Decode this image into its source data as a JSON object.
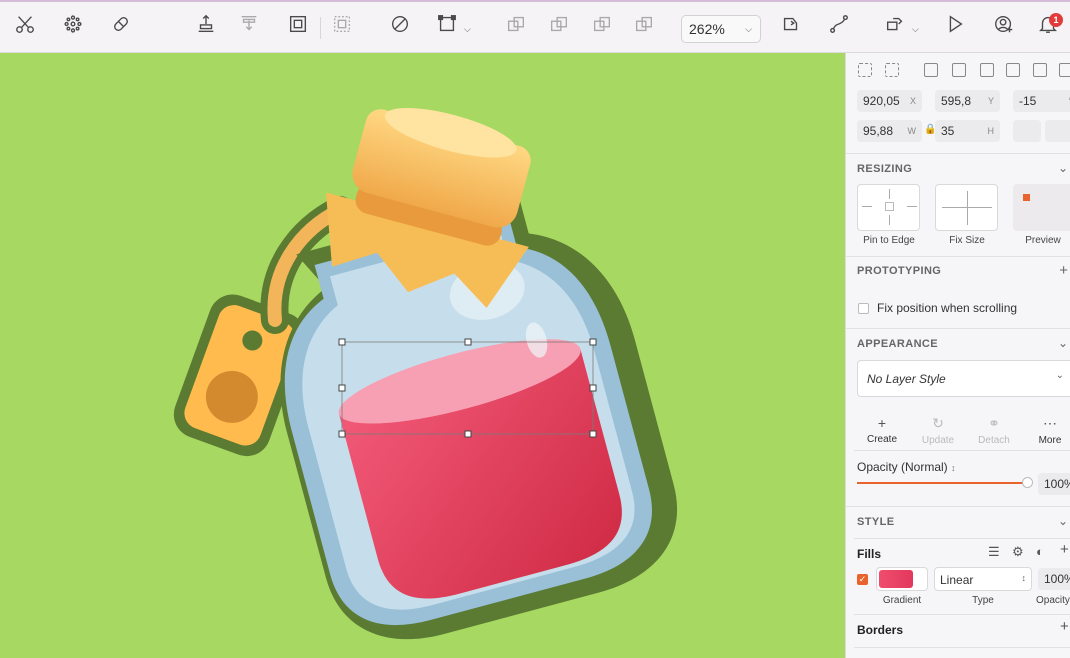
{
  "toolbar": {
    "tools": [
      {
        "name": "scissors-icon"
      },
      {
        "name": "symbol-icon"
      },
      {
        "name": "insert-image-icon"
      },
      {
        "name": "align-bottom-icon"
      },
      {
        "name": "distribute-icon"
      },
      {
        "name": "group-icon"
      },
      {
        "name": "ungroup-icon"
      },
      {
        "name": "mask-icon"
      },
      {
        "name": "transform-icon"
      },
      {
        "name": "union-icon"
      },
      {
        "name": "subtract-icon"
      },
      {
        "name": "intersect-icon"
      },
      {
        "name": "difference-icon"
      },
      {
        "name": "forward-icon"
      },
      {
        "name": "path-edit-icon"
      },
      {
        "name": "prototype-link-icon"
      },
      {
        "name": "play-icon"
      },
      {
        "name": "add-user-icon"
      },
      {
        "name": "bell-icon"
      }
    ],
    "zoom": "262%",
    "notification_count": "1"
  },
  "canvas": {
    "accent_background": "#a6d862",
    "selection_color": "#5a5a5a"
  },
  "inspector": {
    "position": {
      "x": "920,05",
      "x_label": "X",
      "y": "595,8",
      "y_label": "Y",
      "rotation": "-15",
      "rotation_unit": "°"
    },
    "size": {
      "w": "95,88",
      "w_label": "W",
      "h": "35",
      "h_label": "H"
    },
    "resizing": {
      "title": "RESIZING",
      "options": [
        "Pin to Edge",
        "Fix Size",
        "Preview"
      ]
    },
    "prototyping": {
      "title": "PROTOTYPING",
      "fix_position_label": "Fix position when scrolling",
      "fix_position_checked": false
    },
    "appearance": {
      "title": "APPEARANCE",
      "layer_style": "No Layer Style",
      "actions": [
        {
          "label": "Create",
          "icon": "plus-icon",
          "enabled": true
        },
        {
          "label": "Update",
          "icon": "refresh-icon",
          "enabled": false
        },
        {
          "label": "Detach",
          "icon": "detach-icon",
          "enabled": false
        },
        {
          "label": "More",
          "icon": "more-icon",
          "enabled": true
        }
      ],
      "opacity_label": "Opacity (Normal)",
      "opacity_value": "100%",
      "opacity_fraction": 1.0
    },
    "style": {
      "title": "STYLE",
      "fills_title": "Fills",
      "fill": {
        "enabled": true,
        "color_start": "#f04d6e",
        "color_end": "#e2385c",
        "type": "Linear",
        "opacity": "100%",
        "swatch_label": "Gradient",
        "type_label": "Type",
        "opacity_label": "Opacity"
      },
      "borders_title": "Borders"
    }
  }
}
